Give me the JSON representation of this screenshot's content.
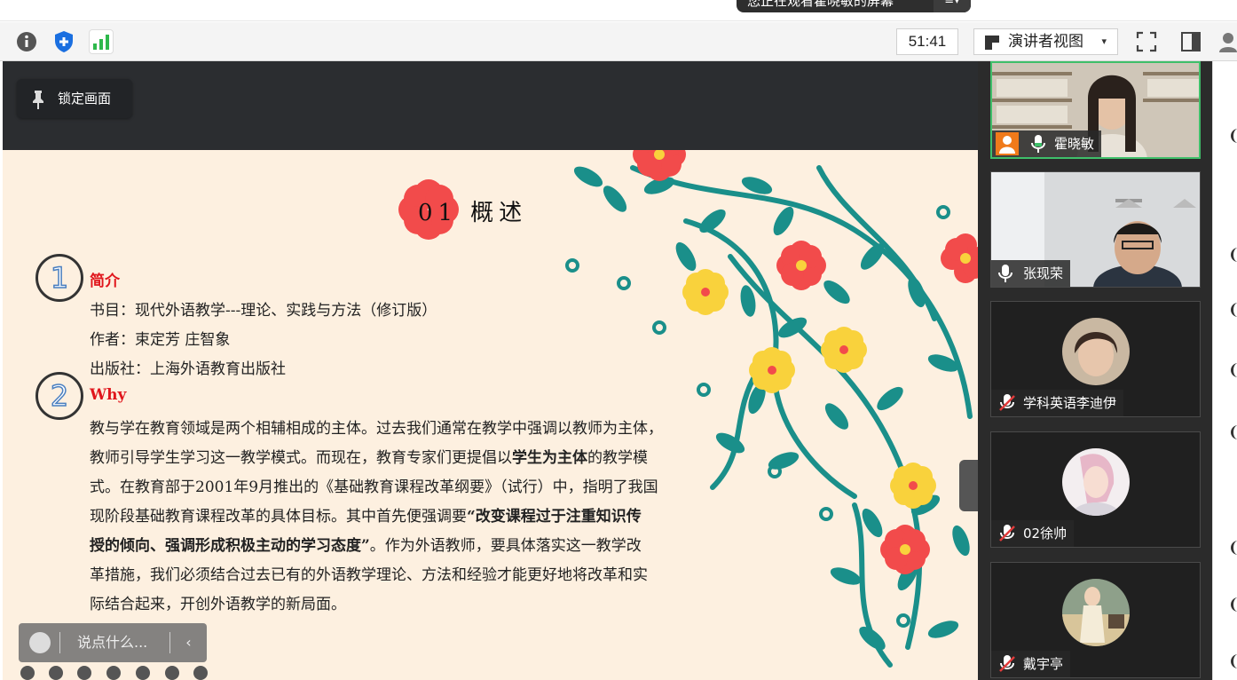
{
  "banner": {
    "text": "您正在观看霍晓敏的屏幕",
    "more": "≡▾"
  },
  "toolbar": {
    "timer": "51:41",
    "view_label": "演讲者视图",
    "caret": "▾"
  },
  "stage": {
    "lock_label": "锁定画面"
  },
  "slide": {
    "title_num": "01",
    "title_text": "概述",
    "section1_num": "1",
    "section1_heading": "简介",
    "book": "书目：现代外语教学---理论、实践与方法（修订版）",
    "authors": "作者：束定芳 庄智象",
    "publisher": "出版社：上海外语教育出版社",
    "section2_num": "2",
    "section2_heading": "Why",
    "para": {
      "l1": "教与学在教育领域是两个相辅相成的主体。过去我们通常在教学中强调以教师为主体，",
      "l2a": "教师引导学生学习这一教学模式。而现在，教育专家们更提倡以",
      "l2b": "学生为主体",
      "l2c": "的教学模",
      "l3": "式。在教育部于2001年9月推出的《基础教育课程改革纲要》（试行）中，指明了我国",
      "l4a": "现阶段基础教育课程改革的具体目标。其中首先便强调要",
      "l4b": "“改变课程过于注重知识传",
      "l5a": "授的倾向、强调形成积极主动的学习态度”",
      "l5b": "。作为外语教师，要具体落实这一教学改",
      "l6": "革措施，我们必须结合过去已有的外语教学理论、方法和经验才能更好地将改革和实",
      "l7": "际结合起来，开创外语教学的新局面。"
    }
  },
  "chat": {
    "placeholder": "说点什么...",
    "arrow": "‹"
  },
  "participants": [
    {
      "name": "霍晓敏",
      "mic": "on"
    },
    {
      "name": "张现荣",
      "mic": "on"
    },
    {
      "name": "学科英语李迪伊",
      "mic": "muted"
    },
    {
      "name": "02徐帅",
      "mic": "muted"
    },
    {
      "name": "戴宇亭",
      "mic": "muted"
    }
  ],
  "colors": {
    "accent_green": "#3fbf6a",
    "slide_bg": "#fdf0e0",
    "teal": "#1a8f8a",
    "flower_red": "#f24b4b",
    "flower_yellow": "#f9d23c",
    "heading_red": "#e0161c"
  }
}
